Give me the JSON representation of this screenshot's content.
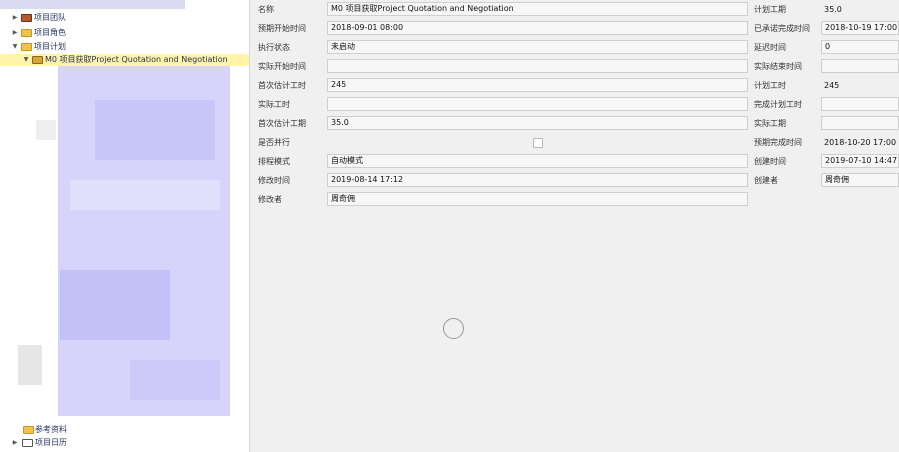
{
  "tree": {
    "items": [
      {
        "label": "项目团队",
        "icon": "box-icon",
        "expanded": false
      },
      {
        "label": "项目角色",
        "icon": "folder-icon",
        "expanded": false
      },
      {
        "label": "项目计划",
        "icon": "folder-icon",
        "expanded": true
      },
      {
        "label": "M0 项目获取Project Quotation and Negotiation",
        "icon": "task-icon",
        "expanded": true,
        "selected": true
      },
      {
        "label": "参考资料",
        "icon": "folder-icon",
        "expanded": false
      },
      {
        "label": "项目日历",
        "icon": "calendar-icon",
        "expanded": false
      }
    ]
  },
  "form": {
    "name_label": "名称",
    "name_value": "M0 项目获取Project Quotation and Negotiation",
    "planned_start_label": "预期开始时间",
    "planned_start_value": "2018-09-01 08:00",
    "status_label": "执行状态",
    "status_value": "未启动",
    "actual_start_label": "实际开始时间",
    "actual_start_value": "",
    "first_est_hours_label": "首次估计工时",
    "first_est_hours_value": "245",
    "actual_hours_label": "实际工时",
    "actual_hours_value": "",
    "first_est_duration_label": "首次估计工期",
    "first_est_duration_value": "35.0",
    "parallel_label": "是否并行",
    "parallel_checked": false,
    "schedule_mode_label": "排程模式",
    "schedule_mode_value": "自动模式",
    "modified_time_label": "修改时间",
    "modified_time_value": "2019-08-14 17:12",
    "modifier_label": "修改者",
    "modifier_value": "周奇佣",
    "planned_duration_label": "计划工期",
    "planned_duration_value": "35.0",
    "committed_finish_label": "已承诺完成时间",
    "committed_finish_value": "2018-10-19 17:00",
    "delay_label": "延迟时间",
    "delay_value": "0",
    "actual_finish_label": "实际结束时间",
    "actual_finish_value": "",
    "planned_hours_label": "计划工时",
    "planned_hours_value": "245",
    "completed_planned_hours_label": "完成计划工时",
    "completed_planned_hours_value": "",
    "actual_duration_label": "实际工期",
    "actual_duration_value": "",
    "expected_finish_label": "预期完成时间",
    "expected_finish_value": "2018-10-20 17:00",
    "created_time_label": "创建时间",
    "created_time_value": "2019-07-10 14:47",
    "creator_label": "创建者",
    "creator_value": "周奇佣"
  }
}
